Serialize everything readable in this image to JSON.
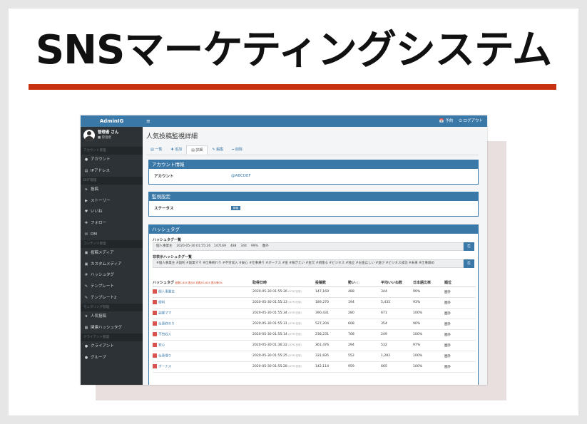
{
  "headline": "SNSマーケティングシステム",
  "app": {
    "brand": "AdminIG",
    "user": {
      "name": "管理者 さん",
      "role": "■ 管理者"
    },
    "topbar": {
      "menu": "≡",
      "links": [
        "📅 予約",
        "⏻ ログアウト"
      ]
    },
    "sidebar": [
      {
        "section": "アカウント管理"
      },
      {
        "icon": "user-icon",
        "glyph": "●",
        "label": "アカウント"
      },
      {
        "icon": "ip-icon",
        "glyph": "▤",
        "label": "IPアドレス"
      },
      {
        "section": "BOT管理"
      },
      {
        "icon": "send-icon",
        "glyph": "➤",
        "label": "投稿"
      },
      {
        "icon": "play-icon",
        "glyph": "▶",
        "label": "ストーリー"
      },
      {
        "icon": "like-icon",
        "glyph": "♥",
        "label": "いいね"
      },
      {
        "icon": "follow-icon",
        "glyph": "✚",
        "label": "フォロー"
      },
      {
        "icon": "mail-icon",
        "glyph": "✉",
        "label": "DM"
      },
      {
        "section": "コンテンツ管理"
      },
      {
        "icon": "media-icon",
        "glyph": "▣",
        "label": "投稿メディア"
      },
      {
        "icon": "custom-media-icon",
        "glyph": "▣",
        "label": "カスタムメディア"
      },
      {
        "icon": "hashtag-icon",
        "glyph": "#",
        "label": "ハッシュタグ"
      },
      {
        "icon": "template-icon",
        "glyph": "✎",
        "label": "テンプレート"
      },
      {
        "icon": "template2-icon",
        "glyph": "✎",
        "label": "テンプレート2"
      },
      {
        "section": "モニタリング管理"
      },
      {
        "icon": "star-icon",
        "glyph": "★",
        "label": "人気投稿"
      },
      {
        "icon": "related-hashtag-icon",
        "glyph": "▦",
        "label": "関連ハッシュタグ"
      },
      {
        "section": "クライアント管理"
      },
      {
        "icon": "client-icon",
        "glyph": "●",
        "label": "クライアント"
      },
      {
        "icon": "group-icon",
        "glyph": "●",
        "label": "グループ"
      }
    ],
    "page_title": "人気投稿監視詳細",
    "tabs": [
      {
        "label": "▤ 一覧",
        "active": false
      },
      {
        "label": "✚ 追加",
        "active": false
      },
      {
        "label": "▤ 詳細",
        "active": true
      },
      {
        "label": "✎ 編集",
        "active": false
      },
      {
        "label": "━ 削除",
        "active": false
      }
    ],
    "account_box": {
      "title": "アカウント情報",
      "key": "アカウント",
      "value": "@ABCDEF"
    },
    "monitor_box": {
      "title": "監視設定",
      "key": "ステータス",
      "value": "稼働"
    },
    "hashtag_box": {
      "title": "ハッシュタグ",
      "list_label": "ハッシュタグ一覧",
      "list_value": "個人事業主　 2020-05-30 01:55:26　147169　 488　 344　 99%　 圏外",
      "hidden_label": "非表示ハッシュタグ一覧",
      "hidden_value": "#個人事業主 #副利 #副業ママ #仕事終わり #不労収入 #安心 #仕事帰り #ボーナス #金 #稼ぎたい #金欠 #頑張る #ビジネス #独立 #お金ほしい #遊び #ビジネス成功 #未来 #仕事辞め",
      "action_glyph": "⎘",
      "columns": [
        {
          "label": "ハッシュタグ",
          "note": "総数1,625 表示0 非表示1,625 表示率0%"
        },
        {
          "label": "取得日時"
        },
        {
          "label": "投稿数"
        },
        {
          "label": "勢い",
          "unit": "(件)"
        },
        {
          "label": "平均いいね数"
        },
        {
          "label": "日本語比率"
        },
        {
          "label": "順位"
        }
      ],
      "rows": [
        {
          "tag": "個人事業主",
          "date": "2020-05-30 01:55:26",
          "ago": "(8793日前)",
          "posts": "147,169",
          "momentum": "488",
          "avg": "344",
          "ratio": "99%",
          "rank": "圏外"
        },
        {
          "tag": "便利",
          "date": "2020-05-30 01:55:13",
          "ago": "(8793日前)",
          "posts": "189,270",
          "momentum": "194",
          "avg": "5,435",
          "ratio": "93%",
          "rank": "圏外"
        },
        {
          "tag": "副業ママ",
          "date": "2020-05-30 01:55:34",
          "ago": "(8793日前)",
          "posts": "390,431",
          "momentum": "280",
          "avg": "671",
          "ratio": "100%",
          "rank": "圏外"
        },
        {
          "tag": "仕事終わり",
          "date": "2020-05-30 01:55:31",
          "ago": "(8793日前)",
          "posts": "527,204",
          "momentum": "608",
          "avg": "354",
          "ratio": "90%",
          "rank": "圏外"
        },
        {
          "tag": "不労収入",
          "date": "2020-05-30 01:55:14",
          "ago": "(8793日前)",
          "posts": "238,231",
          "momentum": "708",
          "avg": "249",
          "ratio": "100%",
          "rank": "圏外"
        },
        {
          "tag": "安心",
          "date": "2020-05-30 01:36:22",
          "ago": "(8792日前)",
          "posts": "361,476",
          "momentum": "294",
          "avg": "532",
          "ratio": "97%",
          "rank": "圏外"
        },
        {
          "tag": "仕事帰り",
          "date": "2020-05-30 01:55:25",
          "ago": "(8793日前)",
          "posts": "331,835",
          "momentum": "552",
          "avg": "1,282",
          "ratio": "100%",
          "rank": "圏外"
        },
        {
          "tag": "ボーナス",
          "date": "2020-05-30 01:55:28",
          "ago": "(8793日前)",
          "posts": "142,114",
          "momentum": "959",
          "avg": "665",
          "ratio": "100%",
          "rank": "圏外"
        }
      ]
    }
  }
}
